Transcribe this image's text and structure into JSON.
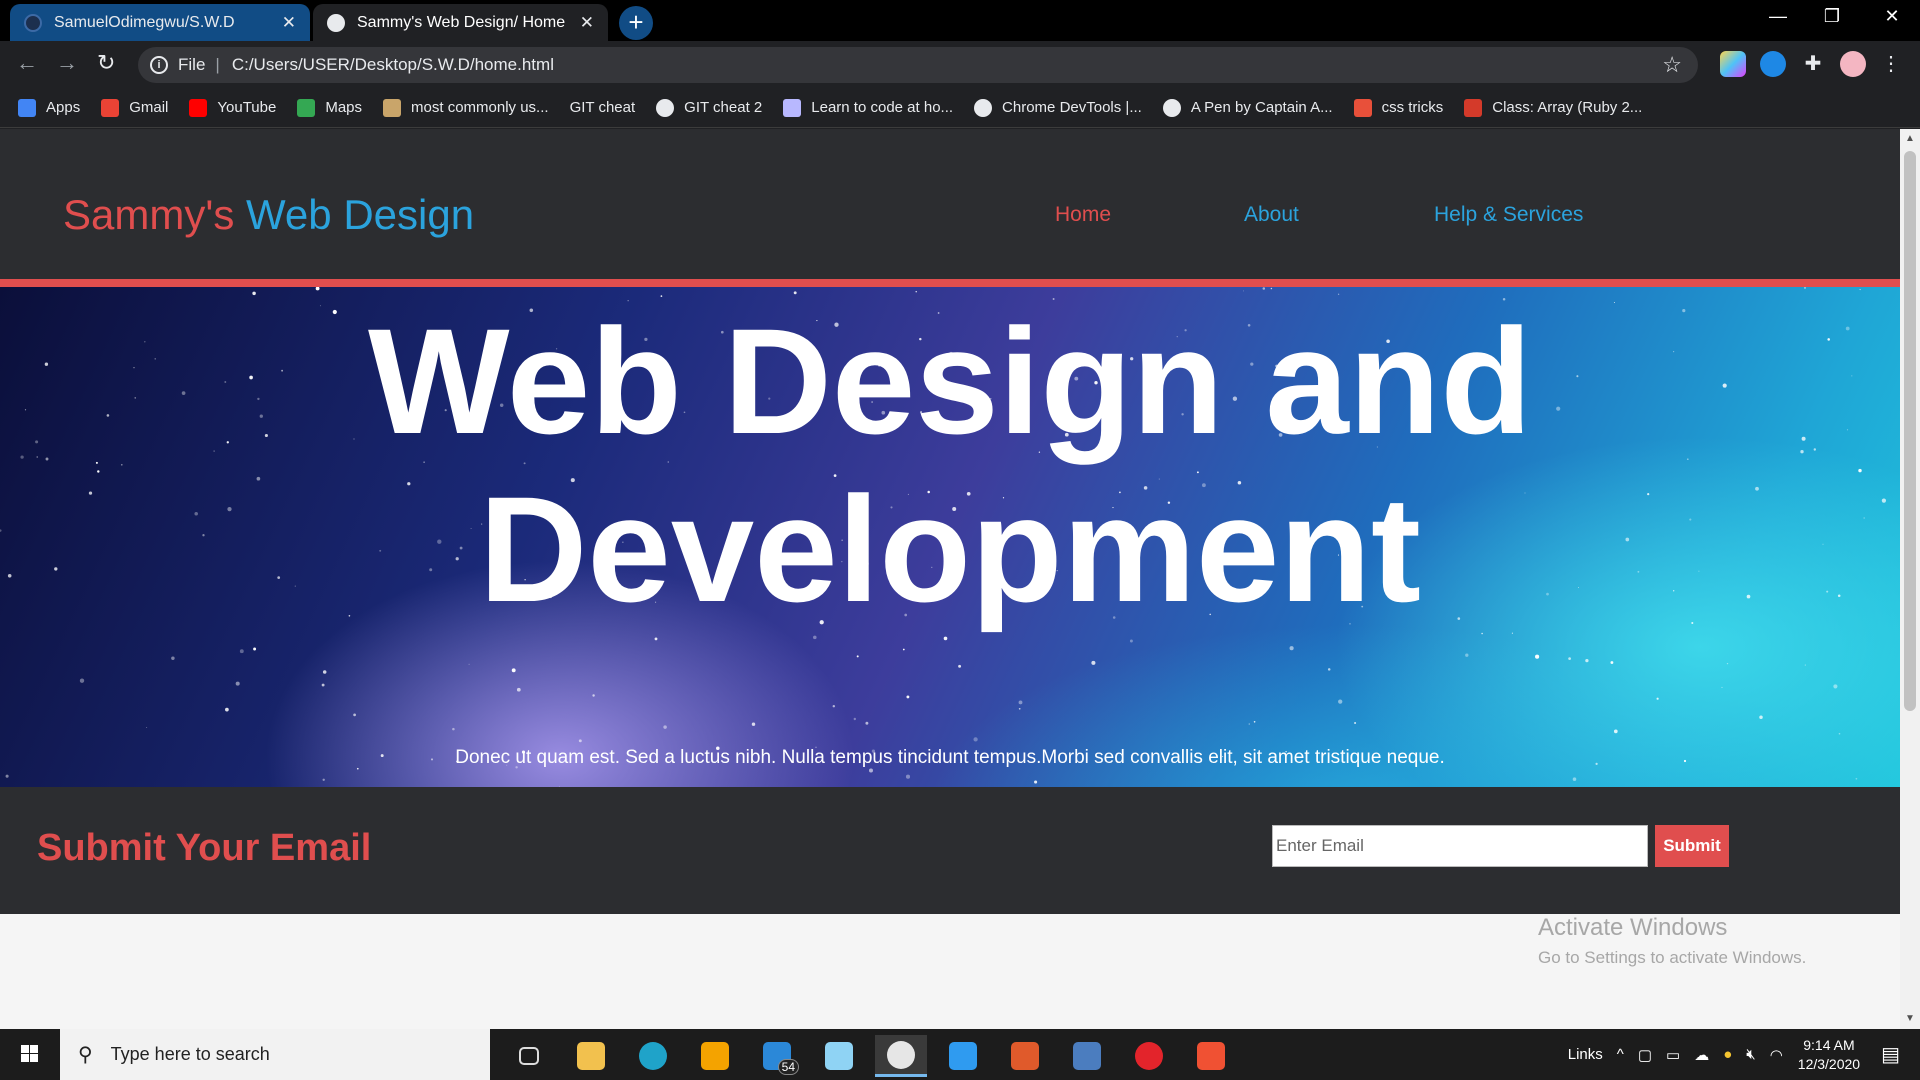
{
  "browser": {
    "tabs": [
      {
        "title": "SamuelOdimegwu/S.W.D",
        "active": false
      },
      {
        "title": "Sammy's Web Design/ Home",
        "active": true
      }
    ],
    "new_tab_icon": "plus-icon",
    "address": {
      "scheme_label": "File",
      "url": "C:/Users/USER/Desktop/S.W.D/home.html"
    },
    "bookmarks": [
      {
        "label": "Apps",
        "icon": "apps-grid-icon",
        "color": "#4285f4"
      },
      {
        "label": "Gmail",
        "icon": "gmail-icon",
        "color": "#ea4335"
      },
      {
        "label": "YouTube",
        "icon": "youtube-icon",
        "color": "#ff0000"
      },
      {
        "label": "Maps",
        "icon": "maps-pin-icon",
        "color": "#34a853"
      },
      {
        "label": "most commonly us...",
        "icon": "bookmark-site-icon",
        "color": "#c9a56a"
      },
      {
        "label": "GIT cheat",
        "icon": "",
        "color": ""
      },
      {
        "label": "GIT cheat 2",
        "icon": "globe-icon",
        "color": "#e8eaed"
      },
      {
        "label": "Learn to code at ho...",
        "icon": "codecademy-icon",
        "color": "#b8b8ff"
      },
      {
        "label": "Chrome DevTools |...",
        "icon": "globe-icon",
        "color": "#e8eaed"
      },
      {
        "label": "A Pen by Captain A...",
        "icon": "codepen-icon",
        "color": "#e8eaed"
      },
      {
        "label": "css tricks",
        "icon": "css-tricks-icon",
        "color": "#e8503a"
      },
      {
        "label": "Class: Array (Ruby 2...",
        "icon": "ruby-icon",
        "color": "#d43a2a"
      }
    ]
  },
  "site": {
    "logo": {
      "part1": "Sammy's",
      "part2": "Web Design"
    },
    "nav": [
      "Home",
      "About",
      "Help & Services"
    ],
    "hero": {
      "title": "Web Design and Development",
      "subtitle": "Donec ut quam est. Sed a luctus nibh. Nulla tempus tincidunt tempus.Morbi sed convallis elit, sit amet tristique neque."
    },
    "email": {
      "heading": "Submit Your Email",
      "placeholder": "Enter Email",
      "button": "Submit"
    },
    "colors": {
      "accent_red": "#e04e4e",
      "accent_blue": "#2ba3dd",
      "header_bg": "#2c2d30"
    }
  },
  "watermark": {
    "line1": "Activate Windows",
    "line2": "Go to Settings to activate Windows."
  },
  "taskbar": {
    "search_placeholder": "Type here to search",
    "apps": [
      {
        "name": "task-view-icon",
        "badge": ""
      },
      {
        "name": "file-explorer-icon",
        "badge": ""
      },
      {
        "name": "edge-icon",
        "badge": ""
      },
      {
        "name": "store-icon",
        "badge": ""
      },
      {
        "name": "mail-icon",
        "badge": "54"
      },
      {
        "name": "notepad-icon",
        "badge": ""
      },
      {
        "name": "chrome-icon",
        "badge": "",
        "active": true
      },
      {
        "name": "vscode-icon",
        "badge": ""
      },
      {
        "name": "office-icon",
        "badge": ""
      },
      {
        "name": "virtualbox-icon",
        "badge": ""
      },
      {
        "name": "opera-icon",
        "badge": ""
      },
      {
        "name": "git-icon",
        "badge": ""
      }
    ],
    "tray": {
      "links_label": "Links",
      "time": "9:14 AM",
      "date": "12/3/2020"
    }
  }
}
